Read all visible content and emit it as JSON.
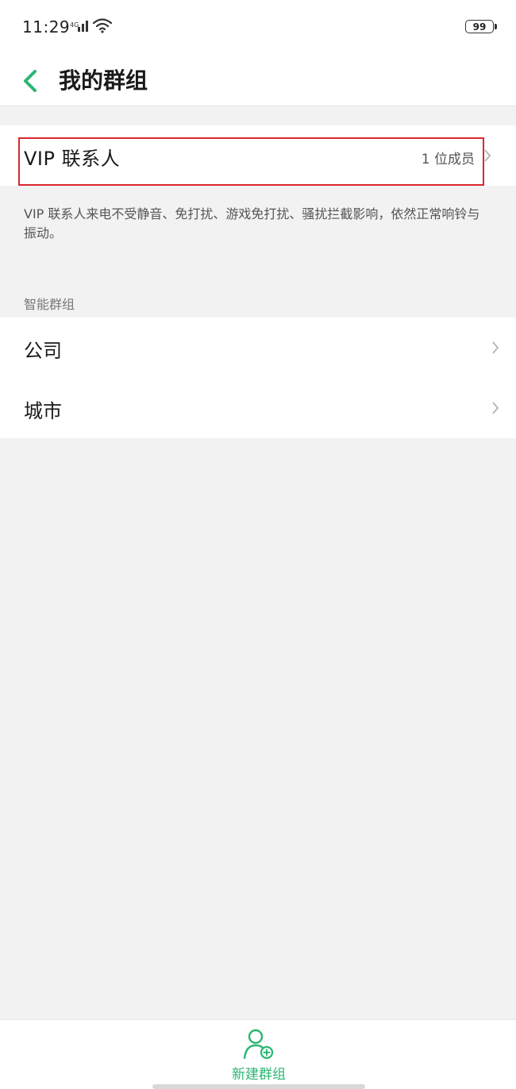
{
  "status_bar": {
    "time": "11:29",
    "battery": "99",
    "icons": [
      "signal-icon",
      "wifi-icon",
      "battery-icon"
    ]
  },
  "header": {
    "title": "我的群组",
    "back_icon": "back-chevron-icon"
  },
  "vip": {
    "label": "VIP 联系人",
    "count": "1 位成员",
    "description": "VIP 联系人来电不受静音、免打扰、游戏免打扰、骚扰拦截影响，依然正常响铃与振动。"
  },
  "smart_groups": {
    "section_title": "智能群组",
    "items": [
      {
        "label": "公司"
      },
      {
        "label": "城市"
      }
    ]
  },
  "bottom": {
    "new_group_label": "新建群组",
    "icon": "add-group-icon"
  },
  "colors": {
    "accent": "#2bb673",
    "highlight": "#d9282f",
    "background": "#f2f2f2"
  }
}
